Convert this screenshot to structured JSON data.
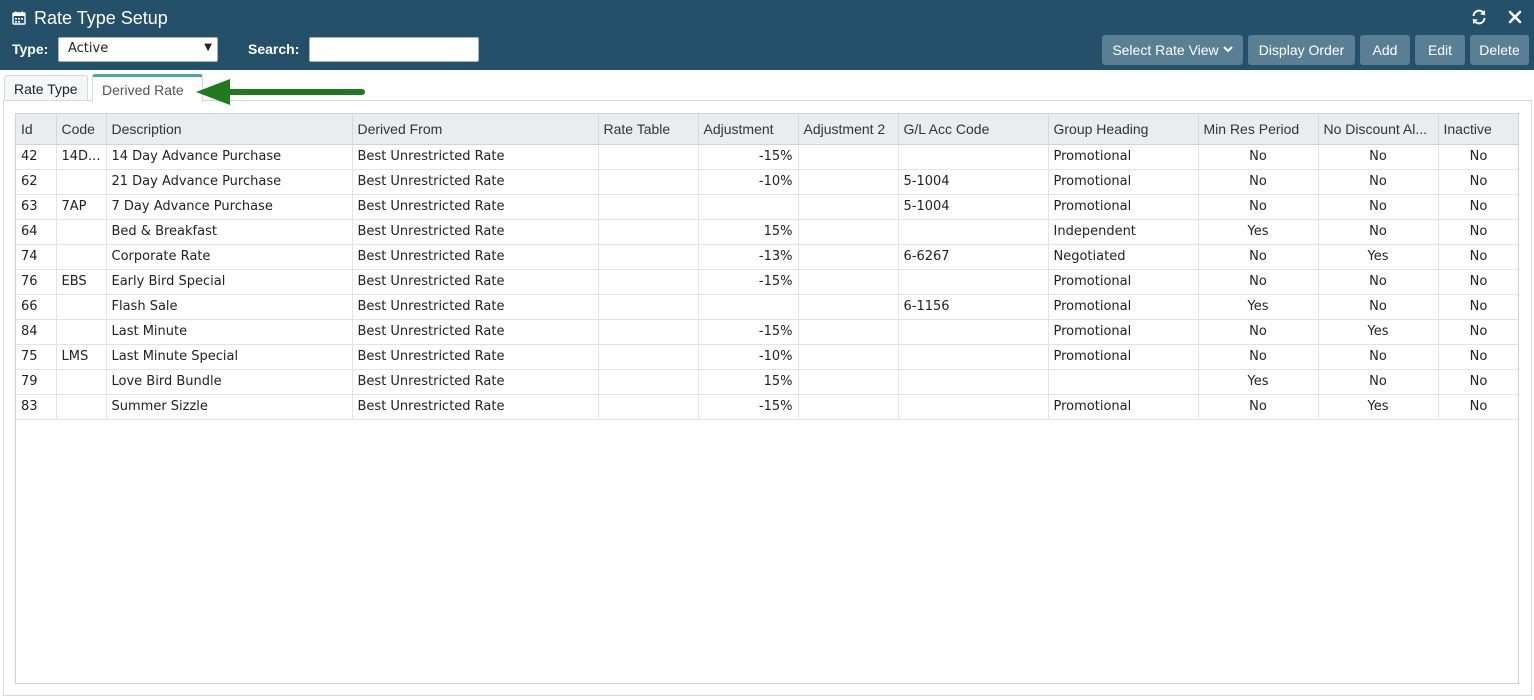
{
  "window": {
    "title": "Rate Type Setup",
    "icons": [
      "calendar-icon",
      "refresh-icon",
      "close-icon"
    ]
  },
  "filters": {
    "type_label": "Type:",
    "type_value": "Active",
    "search_label": "Search:",
    "search_value": ""
  },
  "toolbar": {
    "select_rate_view": "Select Rate View",
    "display_order": "Display Order",
    "add": "Add",
    "edit": "Edit",
    "delete": "Delete"
  },
  "tabs": [
    {
      "label": "Rate Type",
      "active": false
    },
    {
      "label": "Derived Rate",
      "active": true
    }
  ],
  "colors": {
    "header_bg": "#24506a",
    "button_bg": "#5a7f95",
    "tab_accent": "#4aa3b5",
    "arrow": "#1f7a1f"
  },
  "table": {
    "columns": [
      "Id",
      "Code",
      "Description",
      "Derived From",
      "Rate Table",
      "Adjustment",
      "Adjustment 2",
      "G/L Acc Code",
      "Group Heading",
      "Min Res Period",
      "No Discount Al...",
      "Inactive"
    ],
    "rows": [
      [
        "42",
        "14D...",
        "14 Day Advance Purchase",
        "Best Unrestricted Rate",
        "",
        "-15%",
        "",
        "",
        "Promotional",
        "No",
        "No",
        "No"
      ],
      [
        "62",
        "",
        "21 Day Advance Purchase",
        "Best Unrestricted Rate",
        "",
        "-10%",
        "",
        "5-1004",
        "Promotional",
        "No",
        "No",
        "No"
      ],
      [
        "63",
        "7AP",
        "7 Day Advance Purchase",
        "Best Unrestricted Rate",
        "",
        "",
        "",
        "5-1004",
        "Promotional",
        "No",
        "No",
        "No"
      ],
      [
        "64",
        "",
        "Bed & Breakfast",
        "Best Unrestricted Rate",
        "",
        "15%",
        "",
        "",
        "Independent",
        "Yes",
        "No",
        "No"
      ],
      [
        "74",
        "",
        "Corporate Rate",
        "Best Unrestricted Rate",
        "",
        "-13%",
        "",
        "6-6267",
        "Negotiated",
        "No",
        "Yes",
        "No"
      ],
      [
        "76",
        "EBS",
        "Early Bird Special",
        "Best Unrestricted Rate",
        "",
        "-15%",
        "",
        "",
        "Promotional",
        "No",
        "No",
        "No"
      ],
      [
        "66",
        "",
        "Flash Sale",
        "Best Unrestricted Rate",
        "",
        "",
        "",
        "6-1156",
        "Promotional",
        "Yes",
        "No",
        "No"
      ],
      [
        "84",
        "",
        "Last Minute",
        "Best Unrestricted Rate",
        "",
        "-15%",
        "",
        "",
        "Promotional",
        "No",
        "Yes",
        "No"
      ],
      [
        "75",
        "LMS",
        "Last Minute Special",
        "Best Unrestricted Rate",
        "",
        "-10%",
        "",
        "",
        "Promotional",
        "No",
        "No",
        "No"
      ],
      [
        "79",
        "",
        "Love Bird Bundle",
        "Best Unrestricted Rate",
        "",
        "15%",
        "",
        "",
        "",
        "Yes",
        "No",
        "No"
      ],
      [
        "83",
        "",
        "Summer Sizzle",
        "Best Unrestricted Rate",
        "",
        "-15%",
        "",
        "",
        "Promotional",
        "No",
        "Yes",
        "No"
      ]
    ]
  }
}
